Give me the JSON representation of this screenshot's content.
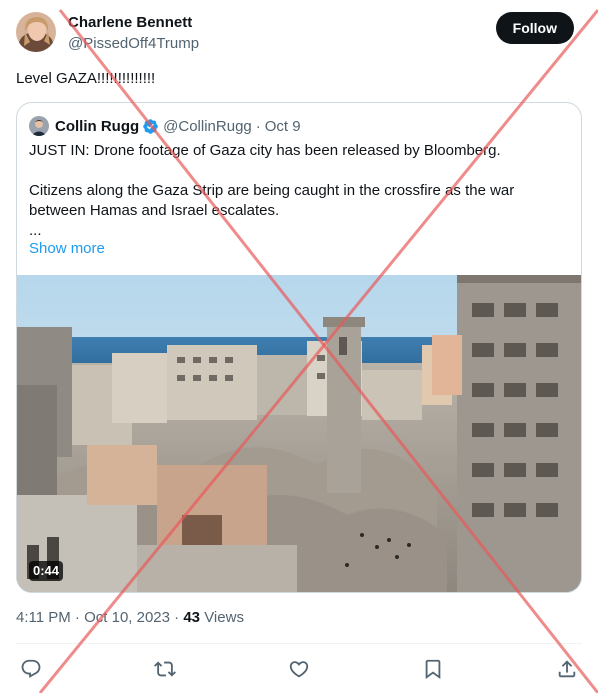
{
  "tweet": {
    "author_name": "Charlene Bennett",
    "author_handle": "@PissedOff4Trump",
    "follow_label": "Follow",
    "text": "Level GAZA!!!!!!!!!!!!!!"
  },
  "quote": {
    "author_name": "Collin Rugg",
    "author_handle": "@CollinRugg",
    "separator": "·",
    "date": "Oct 9",
    "paragraph1": "JUST IN: Drone footage of Gaza city has been released by Bloomberg.",
    "paragraph2": "Citizens along the Gaza Strip are being caught in the crossfire as the war between Hamas and Israel escalates.",
    "ellipsis": "...",
    "show_more": "Show more",
    "video_duration": "0:44"
  },
  "meta": {
    "time": "4:11 PM",
    "separator": "·",
    "date": "Oct 10, 2023",
    "views_count": "43",
    "views_label": "Views"
  },
  "icons": [
    "reply-icon",
    "retweet-icon",
    "like-icon",
    "bookmark-icon",
    "share-icon",
    "verified-icon"
  ],
  "colors": {
    "accent": "#1d9bf0",
    "text": "#0f1419",
    "secondary_text": "#536471",
    "follow_button": "#0f1419",
    "overlay_cross": "#e85a5a"
  }
}
